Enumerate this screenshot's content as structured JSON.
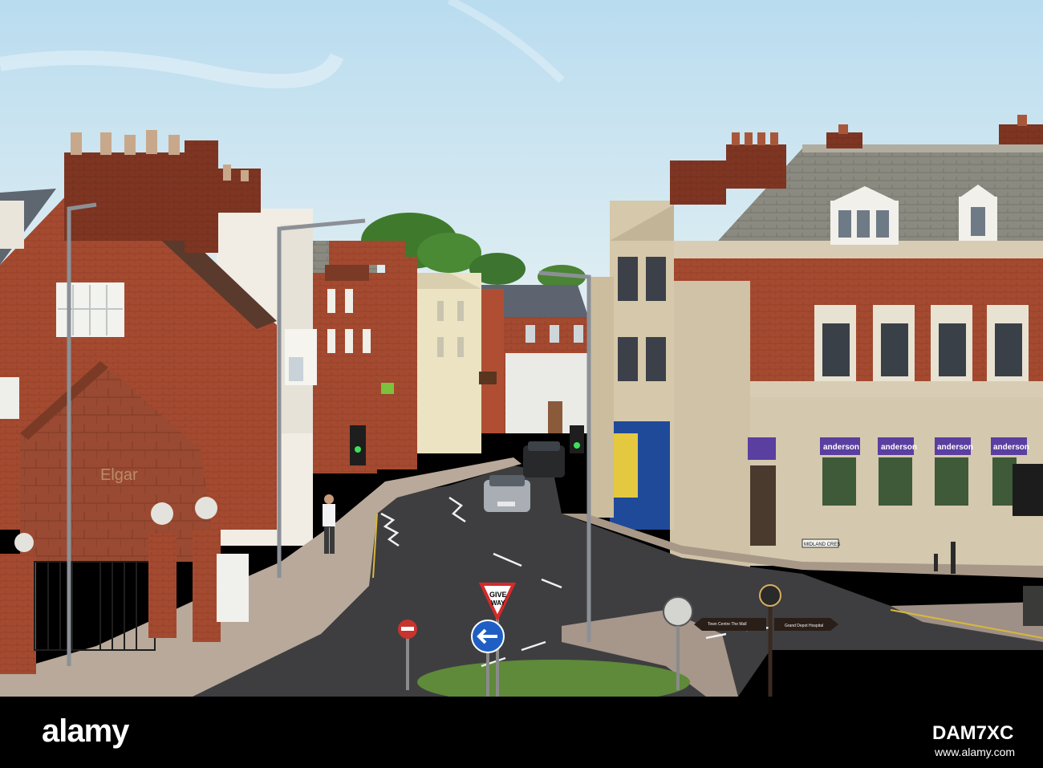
{
  "photo": {
    "signs": {
      "give_way_line1": "GIVE",
      "give_way_line2": "WAY",
      "bank_sign": "anderson",
      "signpost_left": "Town Centre The Mall",
      "signpost_right": "Grand Depot Hospital",
      "street_name": "MIDLAND CRES"
    }
  },
  "watermark": {
    "brand": "alamy",
    "stock_id": "DAM7XC",
    "url": "www.alamy.com"
  }
}
